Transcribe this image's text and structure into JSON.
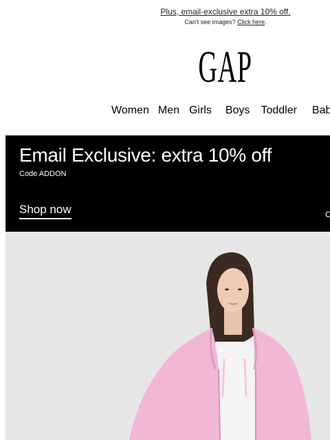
{
  "preheader": {
    "link_text": "Plus, email-exclusive extra 10% off.",
    "images_prefix": "Can't see images? ",
    "images_link": "Click here",
    "images_suffix": "."
  },
  "brand": {
    "logo_text": "GAP"
  },
  "nav": {
    "items": [
      "Women",
      "Men",
      "Girls",
      "Boys",
      "Toddler",
      "Baby"
    ]
  },
  "promo": {
    "title": "Email Exclusive: extra 10% off",
    "code": "Code ADDON",
    "cta": "Shop now",
    "edge_text": "C"
  },
  "colors": {
    "promo_bg": "#000000",
    "hoodie": "#f2b6d6",
    "hero_bg": "#e6e6e6"
  }
}
